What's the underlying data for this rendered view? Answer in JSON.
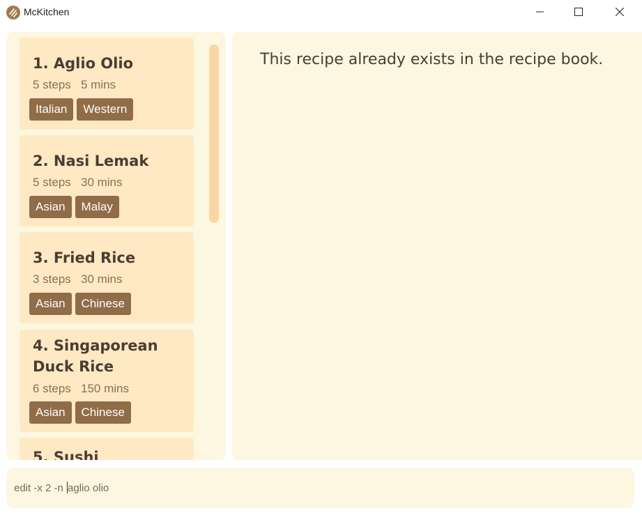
{
  "window": {
    "title": "McKitchen",
    "icon": "mckitchen-logo-icon",
    "controls": [
      "minimize-icon",
      "maximize-icon",
      "close-icon"
    ]
  },
  "recipes": [
    {
      "index_title": "1. Aglio Olio",
      "title_line2": "",
      "steps": "5 steps",
      "time": "5 mins",
      "tags": [
        "Italian",
        "Western"
      ]
    },
    {
      "index_title": "2. Nasi Lemak",
      "title_line2": "",
      "steps": "5 steps",
      "time": "30 mins",
      "tags": [
        "Asian",
        "Malay"
      ]
    },
    {
      "index_title": "3. Fried Rice",
      "title_line2": "",
      "steps": "3 steps",
      "time": "30 mins",
      "tags": [
        "Asian",
        "Chinese"
      ]
    },
    {
      "index_title": "4. Singaporean",
      "title_line2": "Duck Rice",
      "steps": "6 steps",
      "time": "150 mins",
      "tags": [
        "Asian",
        "Chinese"
      ]
    },
    {
      "index_title": "5. Sushi",
      "title_line2": "",
      "steps": "",
      "time": "",
      "tags": []
    }
  ],
  "result": {
    "message": "This recipe already exists in the recipe book."
  },
  "command": {
    "before_caret": "edit -x 2 -n ",
    "after_caret": "aglio olio"
  },
  "colors": {
    "panel_bg": "#fdf6e0",
    "card_bg": "#ffe9c4",
    "tag_bg": "#906c48",
    "scrollbar": "#f9d7a5",
    "text_dark": "#4a3d33",
    "text_meta": "#8a6f50"
  }
}
